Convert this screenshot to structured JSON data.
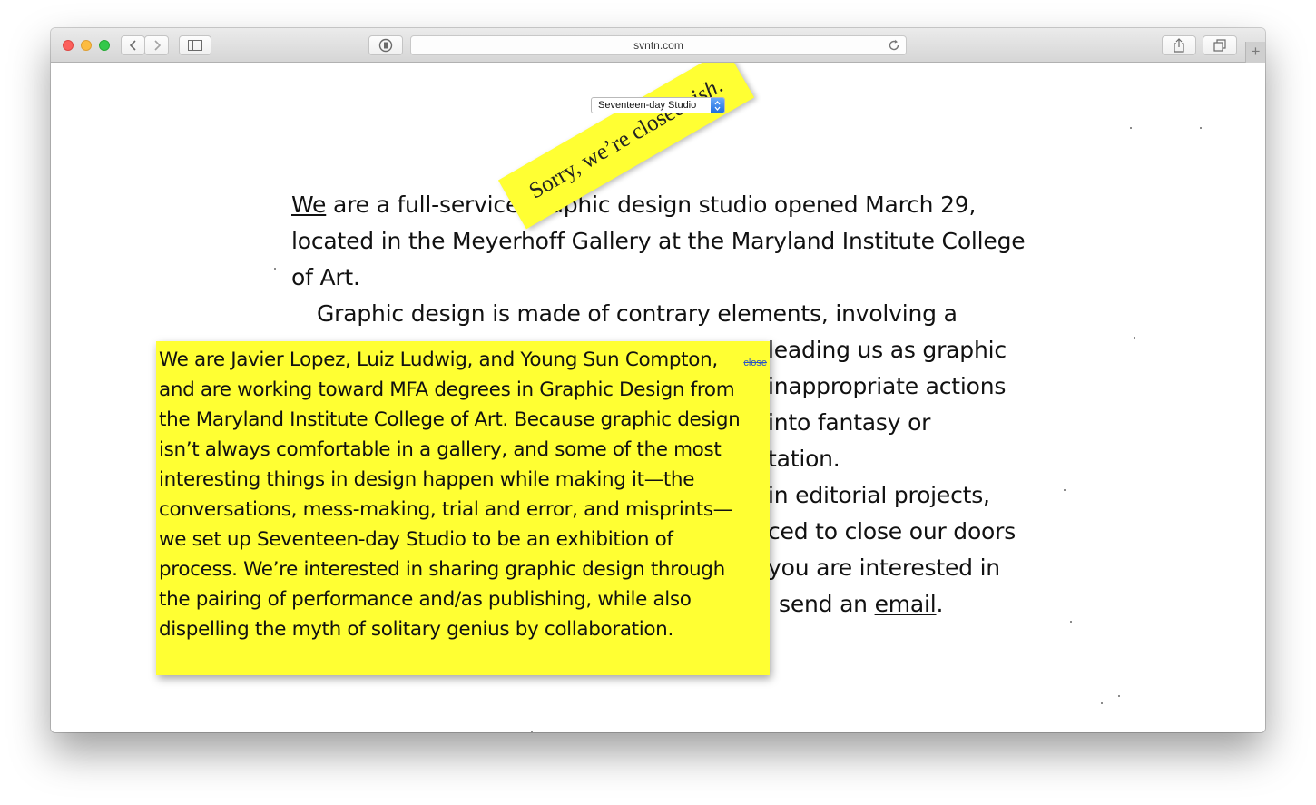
{
  "browser": {
    "url": "svntn.com",
    "new_tab_label": "+"
  },
  "page": {
    "studio_select": {
      "selected": "Seventeen-day Studio"
    },
    "banner": {
      "text": "Sorry, we’re closed–",
      "emphasis": "ish",
      "tail": "."
    },
    "intro": {
      "link_we": "We",
      "p1_rest": " are a full-service graphic design studio opened March 29, located in the Meyerhoff Gallery at the Maryland Institute College of Art.",
      "p2": "Graphic design is made of contrary elements, involving a",
      "p2_line2": "leading us as graphic",
      "p2_line3": "inappropriate actions",
      "p2_line4": "into fantasy or",
      "p2_line5": "tation.",
      "p3_line1": "in editorial projects,",
      "p3_line2": "ced to close our doors",
      "p3_line3": "you are interested in",
      "p3_line4_before": "send an ",
      "link_email": "email",
      "p3_line4_after": "."
    },
    "about_card": {
      "close_label": "close",
      "text": "We are Javier Lopez, Luiz Ludwig, and Young Sun Compton, and are working toward MFA degrees in Graphic Design from the Maryland Institute College of Art. Because graphic design isn’t always comfortable in a gallery, and some of the most interesting things in design happen while making it—the conversations, mess-making, trial and error, and misprints—we set up Seventeen-day Studio to be an exhibition of process. We’re interested in sharing graphic design through the pairing of performance and/as publishing, while also dispelling the myth of solitary genius by collaboration."
    }
  },
  "icons": [
    "back-icon",
    "forward-icon",
    "sidebar-icon",
    "reader-icon",
    "reload-icon",
    "share-icon",
    "tabs-icon",
    "select-arrows-icon"
  ],
  "colors": {
    "highlight": "#ffff33",
    "close_link": "#2a55c8"
  }
}
